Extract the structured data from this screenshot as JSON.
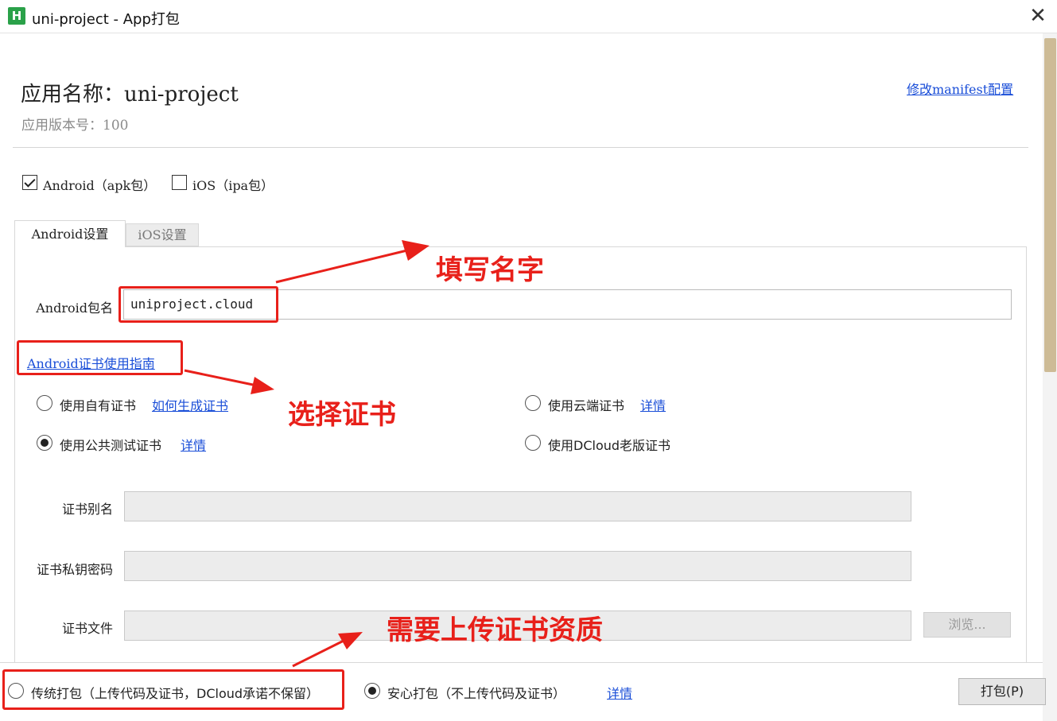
{
  "window": {
    "title": "uni-project - App打包",
    "icon_letter": "H",
    "close_symbol": "✕"
  },
  "header": {
    "app_name": "应用名称：uni-project",
    "app_version": "应用版本号：100",
    "manifest_link": "修改manifest配置"
  },
  "platforms": {
    "android_label": "Android（apk包）",
    "android_checked": true,
    "ios_label": "iOS（ipa包）",
    "ios_checked": false
  },
  "tabs": [
    {
      "label": "Android设置",
      "active": true
    },
    {
      "label": "iOS设置",
      "active": false
    }
  ],
  "android": {
    "package_label": "Android包名",
    "package_value": "uniproject.cloud",
    "cert_guide_link": "Android证书使用指南",
    "cert_options": {
      "own_label": "使用自有证书",
      "own_link": "如何生成证书",
      "public_test_label": "使用公共测试证书",
      "public_test_link": "详情",
      "cloud_label": "使用云端证书",
      "cloud_link": "详情",
      "dcloud_old_label": "使用DCloud老版证书",
      "selected": "public_test"
    },
    "cert_alias_label": "证书别名",
    "cert_password_label": "证书私钥密码",
    "cert_file_label": "证书文件",
    "browse_label": "浏览..."
  },
  "bottom": {
    "traditional_label": "传统打包（上传代码及证书，DCloud承诺不保留）",
    "safe_label": "安心打包（不上传代码及证书）",
    "detail_link": "详情",
    "selected": "safe",
    "pack_button": "打包(P)"
  },
  "annotations": {
    "fill_name": "填写名字",
    "choose_cert": "选择证书",
    "upload_cert": "需要上传证书资质"
  },
  "colors": {
    "accent_link": "#1a4ed8",
    "annotation_red": "#e8201a",
    "app_icon_green": "#2aa149",
    "scroll_thumb": "#cdbb96"
  }
}
